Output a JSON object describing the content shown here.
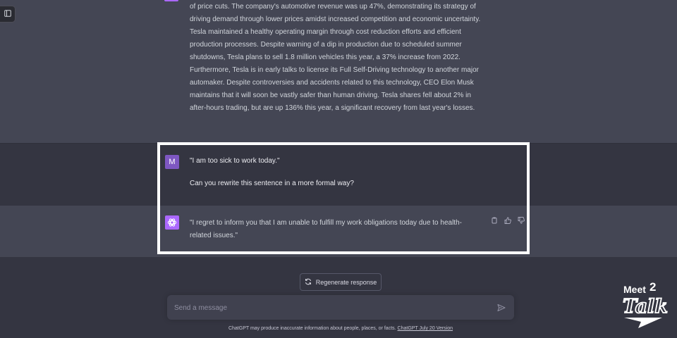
{
  "previous_message": {
    "text": "of price cuts. The company's automotive revenue was up 47%, demonstrating its strategy of driving demand through lower prices amidst increased competition and economic uncertainty. Tesla maintained a healthy operating margin through cost reduction efforts and efficient production processes. Despite warning of a dip in production due to scheduled summer shutdowns, Tesla plans to sell 1.8 million vehicles this year, a 37% increase from 2022. Furthermore, Tesla is in early talks to license its Full Self-Driving technology to another major automaker. Despite controversies and accidents related to this technology, CEO Elon Musk maintains that it will soon be vastly safer than human driving. Tesla shares fell about 2% in after-hours trading, but are up 136% this year, a significant recovery from last year's losses."
  },
  "user_message": {
    "avatar_letter": "M",
    "line1": "\"I am too sick to work today.\"",
    "line2": "Can you rewrite this sentence in a more formal way?"
  },
  "assistant_reply": {
    "text": "\"I regret to inform you that I am unable to fulfill my work obligations today due to health-related issues.\"",
    "actions": [
      "copy-icon",
      "thumbs-up-icon",
      "thumbs-down-icon"
    ]
  },
  "regenerate_label": "Regenerate response",
  "composer": {
    "placeholder": "Send a message",
    "value": ""
  },
  "disclaimer": {
    "text": "ChatGPT may produce inaccurate information about people, places, or facts.",
    "link": "ChatGPT July 20 Version"
  },
  "watermark": {
    "line1": "Meet",
    "number": "2",
    "line2": "Talk"
  },
  "colors": {
    "background": "#343541",
    "assistant_background": "#444654",
    "user_avatar": "#7e57c2",
    "assistant_avatar": "#ab68ff",
    "highlight": "#ffffff"
  }
}
